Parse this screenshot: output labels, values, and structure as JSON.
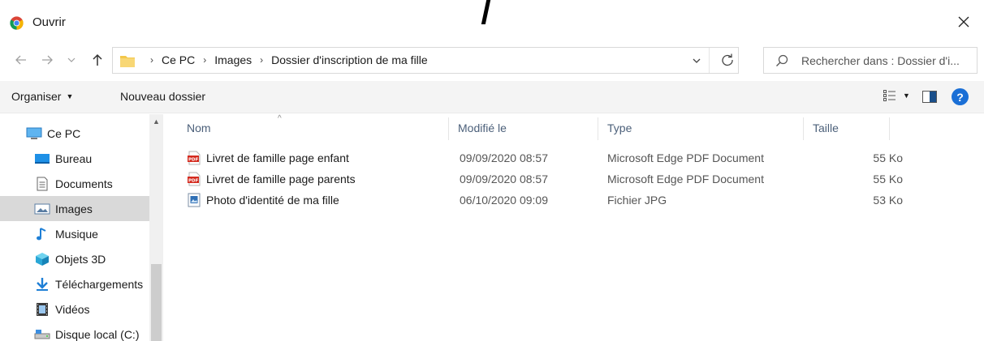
{
  "window": {
    "title": "Ouvrir"
  },
  "address": {
    "crumbs": [
      "Ce PC",
      "Images",
      "Dossier d'inscription de ma fille"
    ]
  },
  "search": {
    "placeholder": "Rechercher dans : Dossier d'i..."
  },
  "toolbar": {
    "organize_label": "Organiser",
    "new_folder_label": "Nouveau dossier"
  },
  "sidebar": {
    "items": [
      {
        "label": "Ce PC",
        "icon": "pc-icon"
      },
      {
        "label": "Bureau",
        "icon": "desktop-icon"
      },
      {
        "label": "Documents",
        "icon": "documents-icon"
      },
      {
        "label": "Images",
        "icon": "images-icon",
        "selected": true
      },
      {
        "label": "Musique",
        "icon": "music-icon"
      },
      {
        "label": "Objets 3D",
        "icon": "objects-3d-icon"
      },
      {
        "label": "Téléchargements",
        "icon": "downloads-icon"
      },
      {
        "label": "Vidéos",
        "icon": "videos-icon"
      },
      {
        "label": "Disque local (C:)",
        "icon": "drive-icon"
      }
    ]
  },
  "filelist": {
    "columns": {
      "name": "Nom",
      "modified": "Modifié le",
      "type": "Type",
      "size": "Taille"
    },
    "rows": [
      {
        "name": "Livret de famille page enfant",
        "modified": "09/09/2020 08:57",
        "type": "Microsoft Edge PDF Document",
        "size": "55 Ko",
        "icon": "pdf-icon"
      },
      {
        "name": "Livret de famille page parents",
        "modified": "09/09/2020 08:57",
        "type": "Microsoft Edge PDF Document",
        "size": "55 Ko",
        "icon": "pdf-icon"
      },
      {
        "name": "Photo d'identité de ma fille",
        "modified": "06/10/2020 09:09",
        "type": "Fichier JPG",
        "size": "53 Ko",
        "icon": "image-file-icon"
      }
    ]
  },
  "colors": {
    "accent": "#1a6fd6",
    "folder": "#f3c74a",
    "pdf_red": "#d42a1e",
    "selected_bg": "#d9d9d9",
    "header_text": "#4c607a"
  }
}
